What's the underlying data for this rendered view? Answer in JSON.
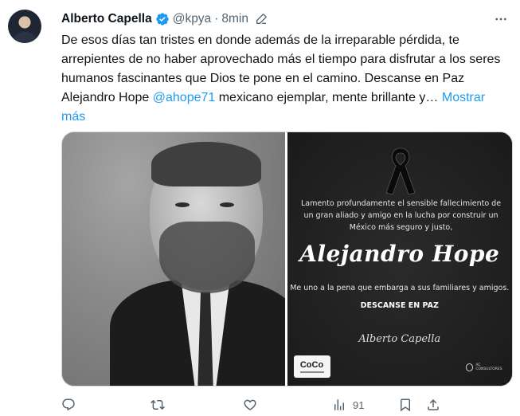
{
  "tweet": {
    "author": {
      "name": "Alberto Capella",
      "handle": "@kpya",
      "separator": "·",
      "time": "8min",
      "verified": true
    },
    "text": {
      "part1": "De esos días tan tristes en donde además de la irreparable pérdida, te arrepientes de no haber aprovechado más el tiempo para disfrutar a los seres humanos fascinantes que Dios te pone en el camino. Descanse en Paz Alejandro Hope ",
      "mention": "@ahope71",
      "part2": " mexicano ejemplar, mente brillante y… ",
      "show_more": "Mostrar más"
    },
    "card": {
      "message": "Lamento profundamente el sensible fallecimiento de un gran aliado y amigo en la lucha por construir un México más seguro y justo,",
      "name": "Alejandro Hope",
      "subtext": "Me uno a la pena que embarga a sus familiares y amigos.",
      "rip": "DESCANSE EN PAZ",
      "signature": "Alberto Capella",
      "logo_left": "CoCo",
      "logo_right": "AC CONSULTORES"
    },
    "actions": {
      "views": "91"
    },
    "colors": {
      "accent": "#1d9bf0",
      "secondary_text": "#536471",
      "primary_text": "#0f1419"
    }
  }
}
